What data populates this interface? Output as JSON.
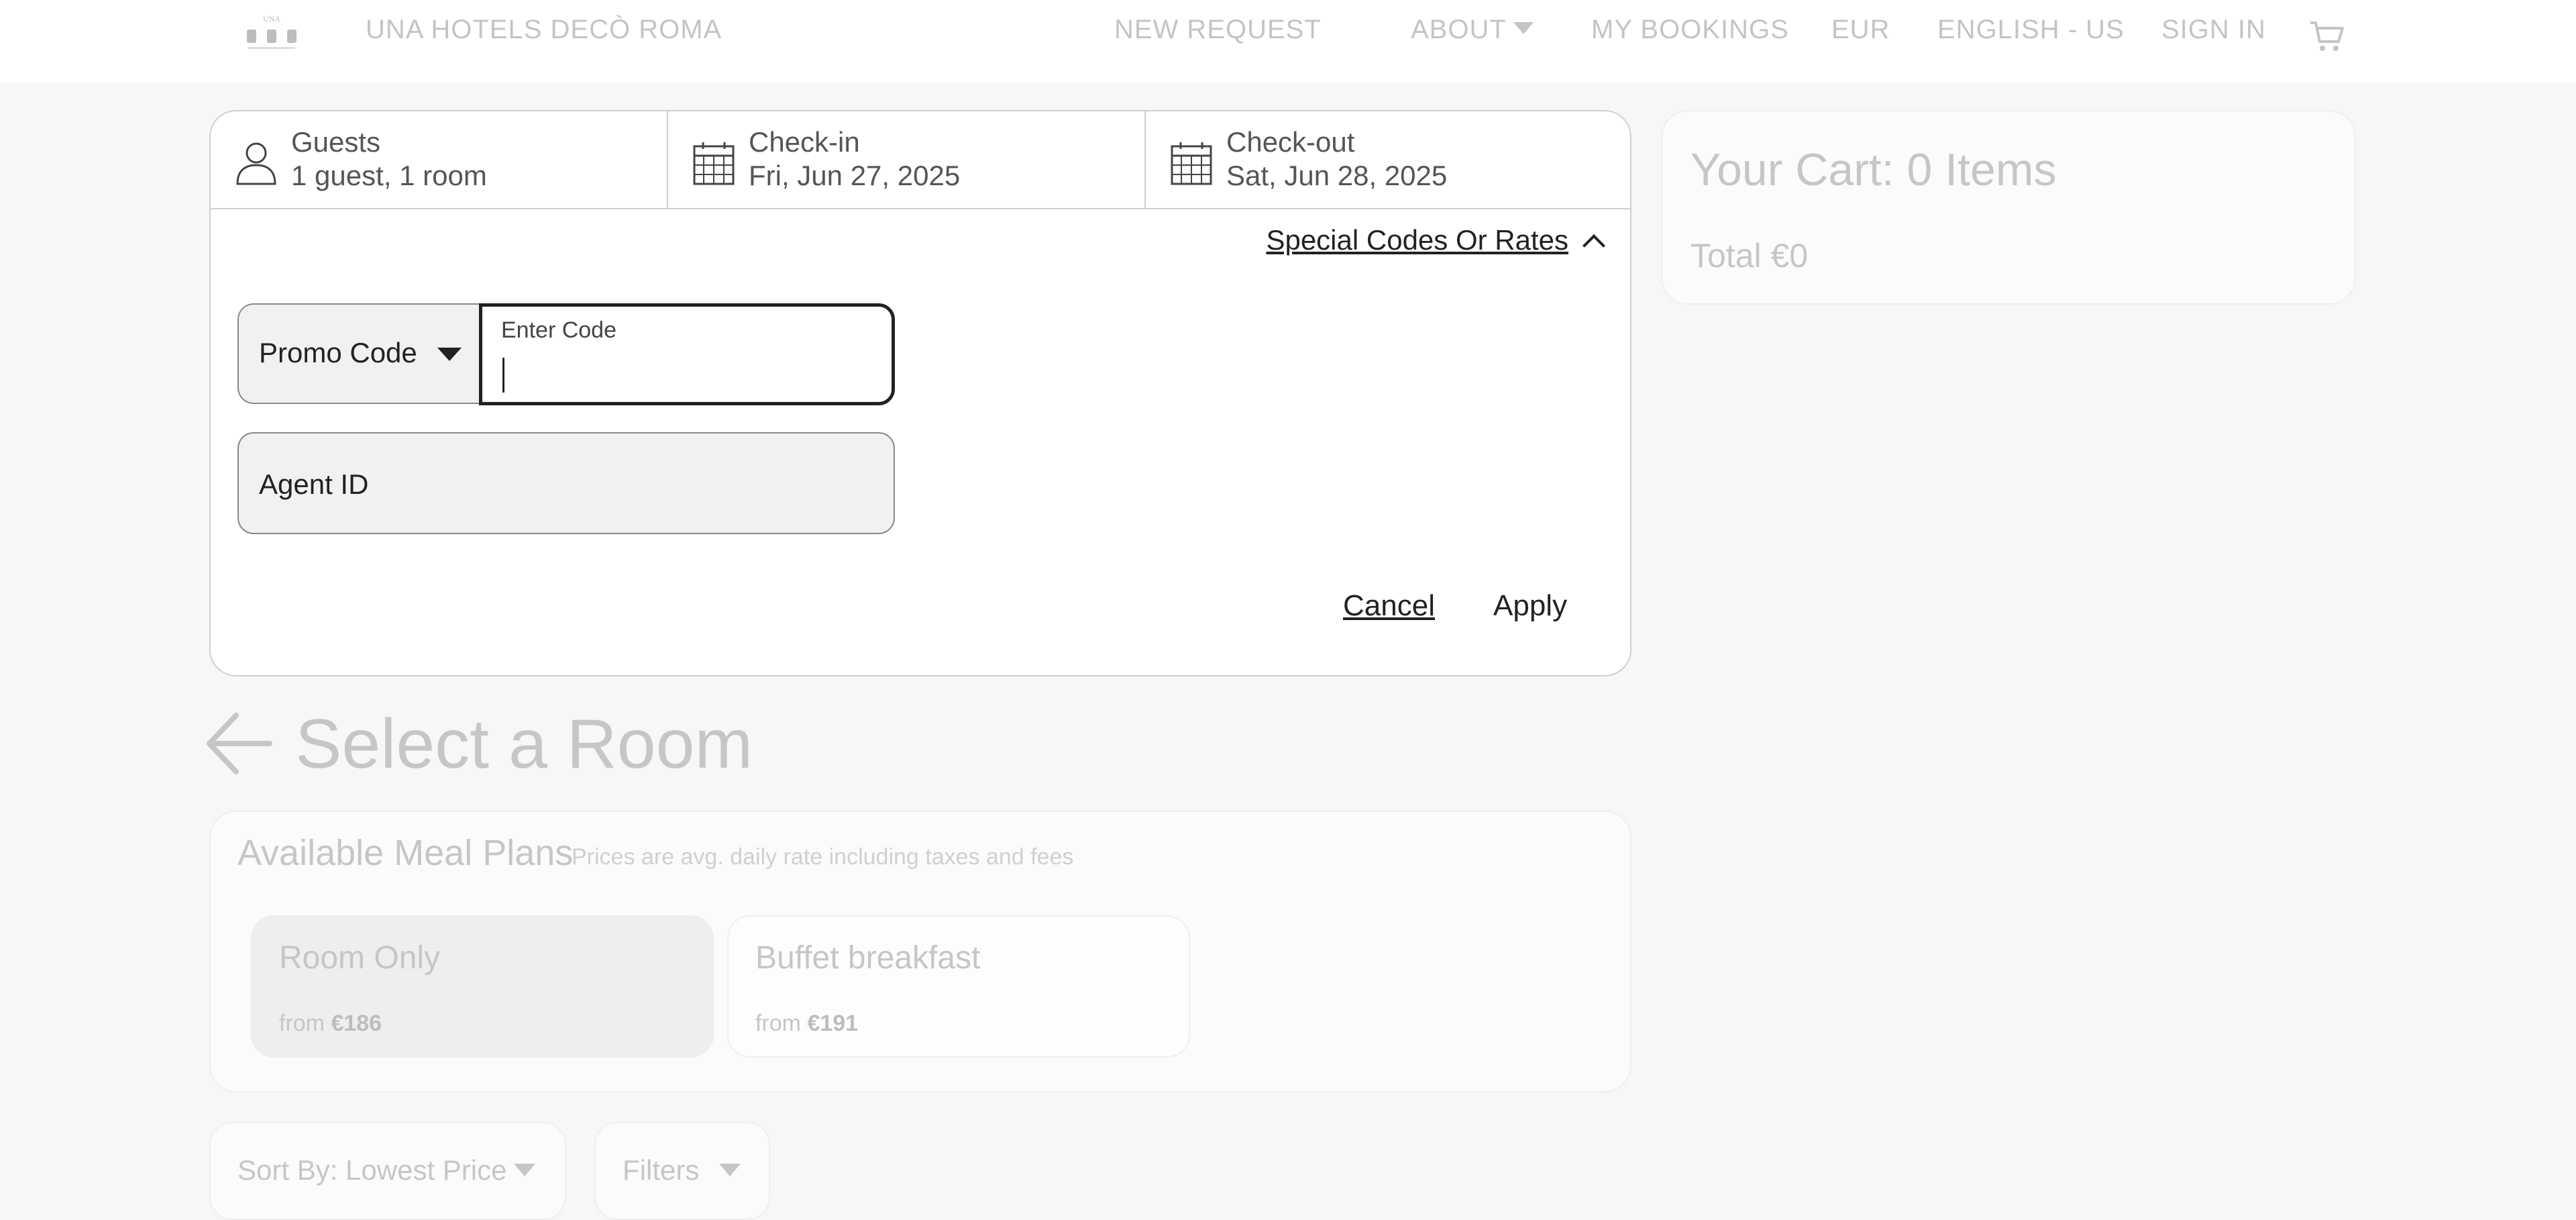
{
  "header": {
    "hotel_name": "UNA HOTELS DECÒ ROMA",
    "logo_text": "UNA",
    "nav": {
      "new_request": "NEW REQUEST",
      "about": "ABOUT",
      "my_bookings": "MY BOOKINGS",
      "currency": "EUR",
      "language": "ENGLISH - US",
      "sign_in": "SIGN IN"
    }
  },
  "booking_bar": {
    "guests_label": "Guests",
    "guests_value": "1 guest, 1 room",
    "checkin_label": "Check-in",
    "checkin_value": "Fri, Jun 27, 2025",
    "checkout_label": "Check-out",
    "checkout_value": "Sat, Jun 28, 2025"
  },
  "special_codes": {
    "toggle_label": "Special Codes Or Rates",
    "code_type": "Promo Code",
    "code_input_label": "Enter Code",
    "code_value": "",
    "agent_placeholder": "Agent ID",
    "cancel_label": "Cancel",
    "apply_label": "Apply"
  },
  "cart": {
    "title": "Your Cart: 0 Items",
    "total": "Total €0"
  },
  "main": {
    "title": "Select a Room",
    "meal_plans": {
      "title": "Available Meal Plans",
      "note": "Prices are avg. daily rate including taxes and fees",
      "options": [
        {
          "name": "Room Only",
          "from": "from",
          "price": "€186",
          "selected": true
        },
        {
          "name": "Buffet breakfast",
          "from": "from",
          "price": "€191",
          "selected": false
        }
      ]
    },
    "sort_label": "Sort By: Lowest Price",
    "filters_label": "Filters"
  },
  "colors": {
    "muted_text": "#c6c6c6",
    "border": "#cfcfcf",
    "dark_text": "#222222",
    "background": "#f7f7f7"
  }
}
